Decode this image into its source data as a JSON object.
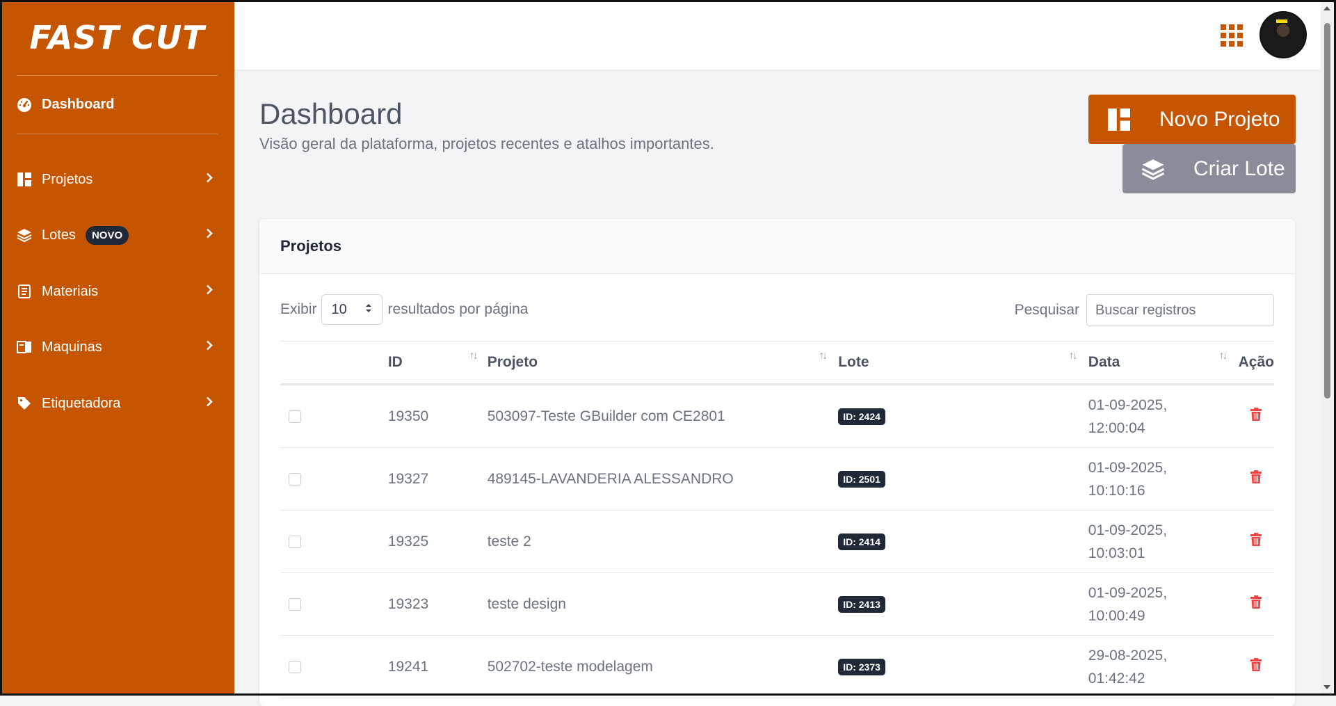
{
  "brand": {
    "name": "FAST CUT"
  },
  "sidebar": {
    "dashboard_label": "Dashboard",
    "items": [
      {
        "label": "Projetos",
        "icon": "panels-icon"
      },
      {
        "label": "Lotes",
        "icon": "layers-icon",
        "badge": "NOVO"
      },
      {
        "label": "Materiais",
        "icon": "list-icon"
      },
      {
        "label": "Maquinas",
        "icon": "machine-icon"
      },
      {
        "label": "Etiquetadora",
        "icon": "tag-icon"
      }
    ]
  },
  "header": {
    "title": "Dashboard",
    "subtitle": "Visão geral da plataforma, projetos recentes e atalhos importantes.",
    "primary_button": "Novo Projeto",
    "secondary_button": "Criar Lote"
  },
  "card": {
    "title": "Projetos",
    "show_label": "Exibir",
    "page_size": "10",
    "per_page_label": "resultados por página",
    "search_label": "Pesquisar",
    "search_placeholder": "Buscar registros",
    "columns": {
      "id": "ID",
      "project": "Projeto",
      "lote": "Lote",
      "date": "Data",
      "action": "Ação"
    },
    "rows": [
      {
        "id": "19350",
        "project": "503097-Teste GBuilder com CE2801",
        "lote": "ID: 2424",
        "date_line1": "01-09-2025,",
        "date_line2": "12:00:04"
      },
      {
        "id": "19327",
        "project": "489145-LAVANDERIA ALESSANDRO",
        "lote": "ID: 2501",
        "date_line1": "01-09-2025,",
        "date_line2": "10:10:16"
      },
      {
        "id": "19325",
        "project": "teste 2",
        "lote": "ID: 2414",
        "date_line1": "01-09-2025,",
        "date_line2": "10:03:01"
      },
      {
        "id": "19323",
        "project": "teste design",
        "lote": "ID: 2413",
        "date_line1": "01-09-2025,",
        "date_line2": "10:00:49"
      },
      {
        "id": "19241",
        "project": "502702-teste modelagem",
        "lote": "ID: 2373",
        "date_line1": "29-08-2025,",
        "date_line2": "01:42:42"
      }
    ]
  },
  "colors": {
    "brand_orange": "#c55500",
    "dark_badge": "#1f2937",
    "secondary_button": "#8a8d99",
    "trash_red": "#ef4444"
  }
}
